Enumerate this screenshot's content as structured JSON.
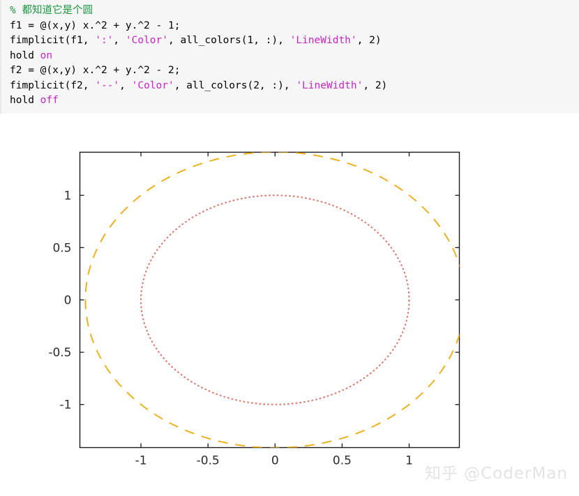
{
  "code_block": {
    "background_color": "#f6f6f6",
    "comment_color": "#1a9641",
    "string_color": "#c724c7",
    "lines": [
      {
        "id": "line-1",
        "segments": [
          {
            "cls": "tok-comment",
            "text": "% 都知道它是个圆"
          }
        ]
      },
      {
        "id": "line-2",
        "segments": [
          {
            "cls": "tok-plain",
            "text": "f1 = @(x,y) x.^2 + y.^2 - 1;"
          }
        ]
      },
      {
        "id": "line-3",
        "segments": [
          {
            "cls": "tok-plain",
            "text": "fimplicit(f1, "
          },
          {
            "cls": "tok-string",
            "text": "':'"
          },
          {
            "cls": "tok-plain",
            "text": ", "
          },
          {
            "cls": "tok-string",
            "text": "'Color'"
          },
          {
            "cls": "tok-plain",
            "text": ", all_colors(1, :), "
          },
          {
            "cls": "tok-string",
            "text": "'LineWidth'"
          },
          {
            "cls": "tok-plain",
            "text": ", 2)"
          }
        ]
      },
      {
        "id": "line-4",
        "segments": [
          {
            "cls": "tok-plain",
            "text": "hold "
          },
          {
            "cls": "tok-kw",
            "text": "on"
          }
        ]
      },
      {
        "id": "line-5",
        "segments": [
          {
            "cls": "tok-plain",
            "text": "f2 = @(x,y) x.^2 + y.^2 - 2;"
          }
        ]
      },
      {
        "id": "line-6",
        "segments": [
          {
            "cls": "tok-plain",
            "text": "fimplicit(f2, "
          },
          {
            "cls": "tok-string",
            "text": "'--'"
          },
          {
            "cls": "tok-plain",
            "text": ", "
          },
          {
            "cls": "tok-string",
            "text": "'Color'"
          },
          {
            "cls": "tok-plain",
            "text": ", all_colors(2, :), "
          },
          {
            "cls": "tok-string",
            "text": "'LineWidth'"
          },
          {
            "cls": "tok-plain",
            "text": ", 2)"
          }
        ]
      },
      {
        "id": "line-7",
        "segments": [
          {
            "cls": "tok-plain",
            "text": "hold "
          },
          {
            "cls": "tok-kw",
            "text": "off"
          }
        ]
      }
    ]
  },
  "chart_data": {
    "type": "line",
    "title": "",
    "xlabel": "",
    "ylabel": "",
    "xlim": [
      -1.4554,
      1.3744
    ],
    "ylim": [
      -1.4118,
      1.4118
    ],
    "xticks": [
      -1,
      -0.5,
      0,
      0.5,
      1
    ],
    "xticklabels": [
      "-1",
      "-0.5",
      "0",
      "0.5",
      "1"
    ],
    "yticks": [
      -1,
      -0.5,
      0,
      0.5,
      1
    ],
    "yticklabels": [
      "-1",
      "-0.5",
      "0",
      "0.5",
      "1"
    ],
    "grid": false,
    "legend": null,
    "axes_box": true,
    "series": [
      {
        "name": "f1: x.^2 + y.^2 - 1 = 0",
        "shape": "circle",
        "center": [
          0,
          0
        ],
        "radius": 1,
        "color": "#d9756b",
        "linestyle": "dotted",
        "linewidth": 2
      },
      {
        "name": "f2: x.^2 + y.^2 - 2 = 0",
        "shape": "circle",
        "center": [
          0,
          0
        ],
        "radius": 1.41421356,
        "color": "#edb120",
        "linestyle": "dashed",
        "linewidth": 2
      }
    ]
  },
  "watermark": {
    "text": "知乎 @CoderMan",
    "color": "#e3e3e3"
  }
}
